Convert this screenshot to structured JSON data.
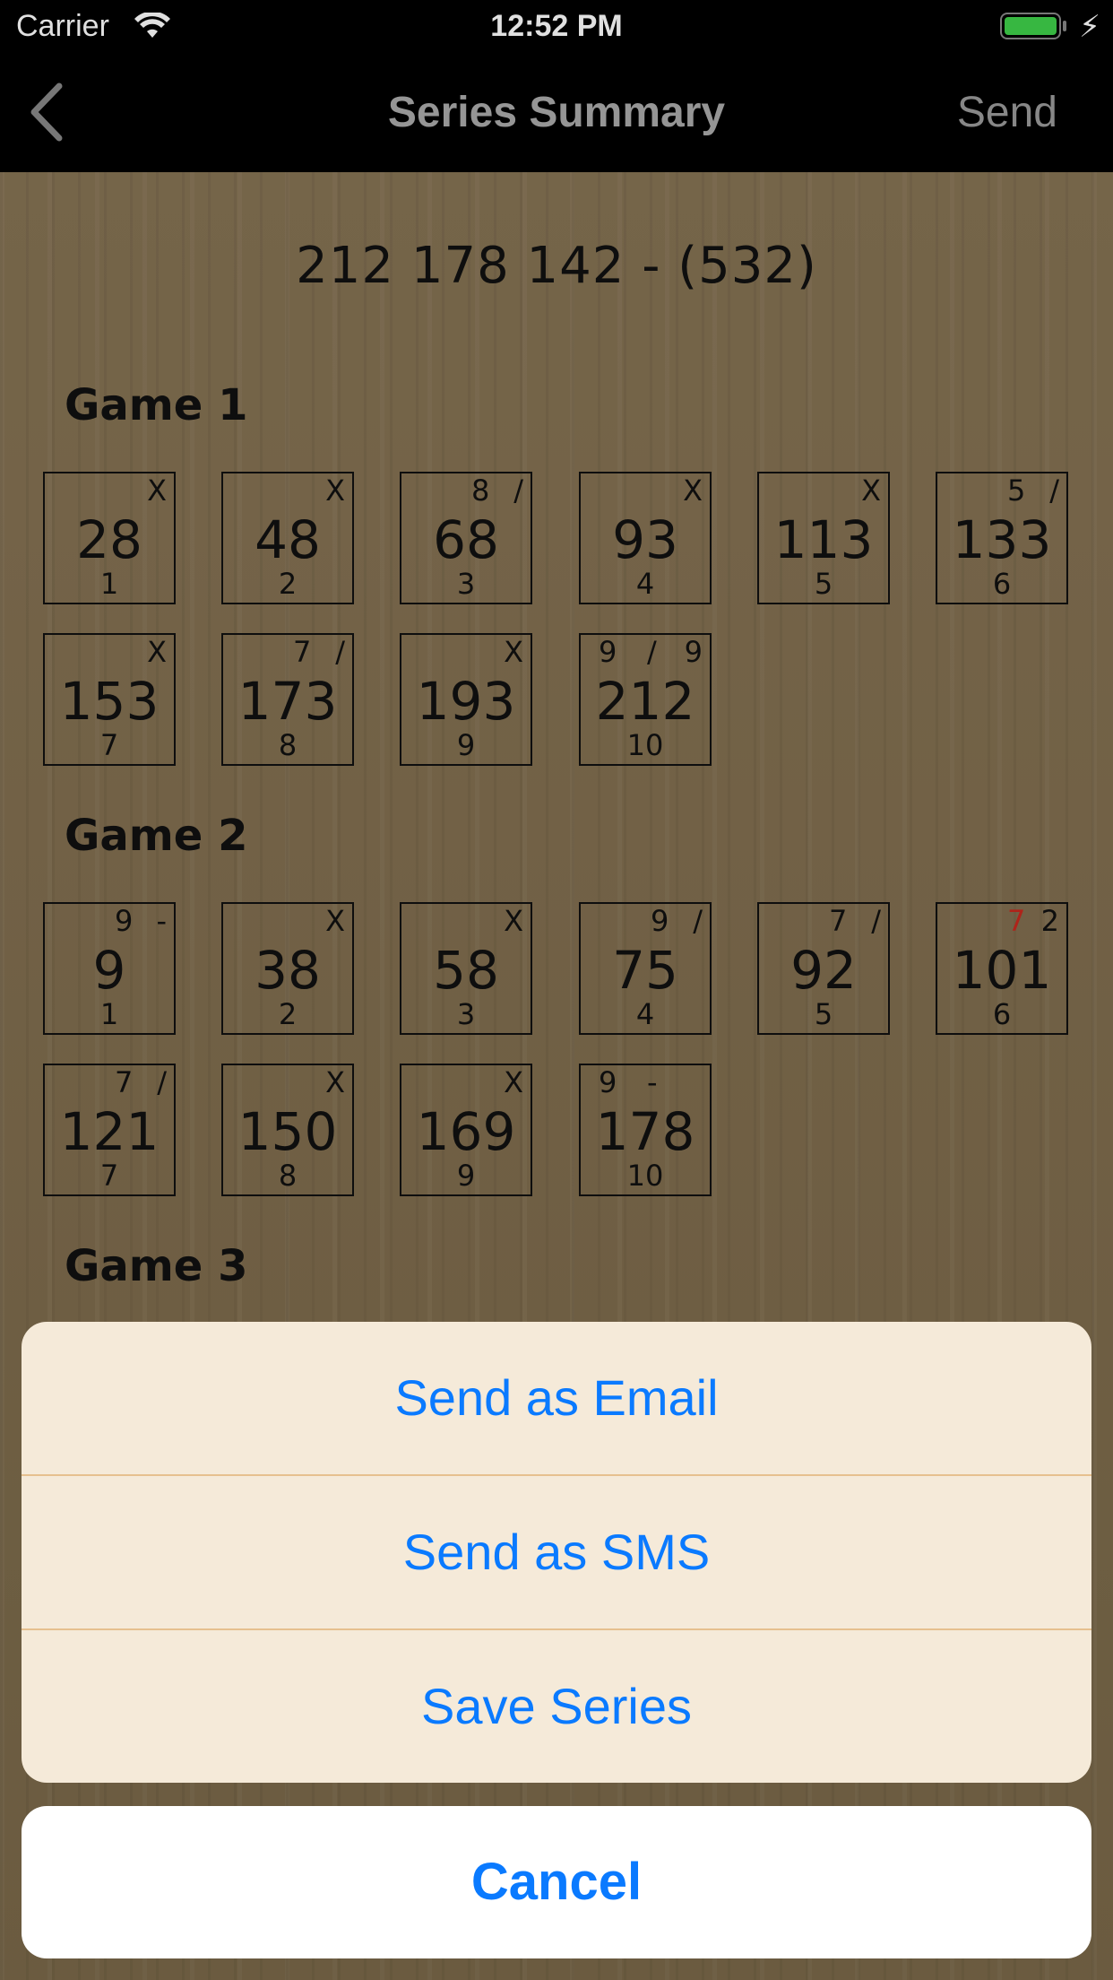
{
  "status_bar": {
    "carrier": "Carrier",
    "time": "12:52 PM"
  },
  "nav": {
    "title": "Series Summary",
    "send_label": "Send"
  },
  "series_scores": "212 178 142 - (532)",
  "games": [
    {
      "label": "Game 1",
      "frames": [
        {
          "b1": "",
          "b2": "X",
          "total": "28",
          "num": "1"
        },
        {
          "b1": "",
          "b2": "X",
          "total": "48",
          "num": "2"
        },
        {
          "b1": "8",
          "b2": "/",
          "total": "68",
          "num": "3"
        },
        {
          "b1": "",
          "b2": "X",
          "total": "93",
          "num": "4"
        },
        {
          "b1": "",
          "b2": "X",
          "total": "113",
          "num": "5"
        },
        {
          "b1": "5",
          "b2": "/",
          "total": "133",
          "num": "6"
        },
        {
          "b1": "",
          "b2": "X",
          "total": "153",
          "num": "7"
        },
        {
          "b1": "7",
          "b2": "/",
          "total": "173",
          "num": "8"
        },
        {
          "b1": "",
          "b2": "X",
          "total": "193",
          "num": "9"
        },
        {
          "b1": "9",
          "b2": "/",
          "b3": "9",
          "total": "212",
          "num": "10"
        }
      ]
    },
    {
      "label": "Game 2",
      "frames": [
        {
          "b1": "9",
          "b2": "-",
          "total": "9",
          "num": "1"
        },
        {
          "b1": "",
          "b2": "X",
          "total": "38",
          "num": "2"
        },
        {
          "b1": "",
          "b2": "X",
          "total": "58",
          "num": "3"
        },
        {
          "b1": "9",
          "b2": "/",
          "total": "75",
          "num": "4"
        },
        {
          "b1": "7",
          "b2": "/",
          "total": "92",
          "num": "5"
        },
        {
          "b1": "7",
          "b2": "2",
          "total": "101",
          "num": "6",
          "b1_red": true
        },
        {
          "b1": "7",
          "b2": "/",
          "total": "121",
          "num": "7"
        },
        {
          "b1": "",
          "b2": "X",
          "total": "150",
          "num": "8"
        },
        {
          "b1": "",
          "b2": "X",
          "total": "169",
          "num": "9"
        },
        {
          "b1": "9",
          "b2": "-",
          "b3": "",
          "total": "178",
          "num": "10"
        }
      ]
    },
    {
      "label": "Game 3",
      "frames": []
    }
  ],
  "action_sheet": {
    "email": "Send as Email",
    "sms": "Send as SMS",
    "save": "Save Series",
    "cancel": "Cancel"
  },
  "colors": {
    "accent": "#0a7aff",
    "strike_red": "#c8281e",
    "battery": "#3fd14a"
  }
}
